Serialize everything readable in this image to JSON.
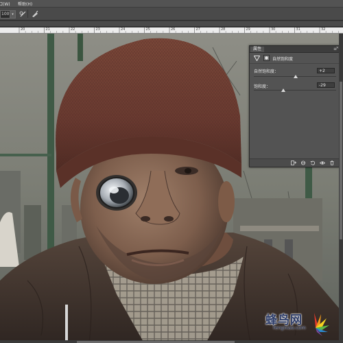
{
  "menu": {
    "window": "窗口(W)",
    "help": "帮助(H)"
  },
  "options": {
    "zoom": "100%"
  },
  "ruler": {
    "labels": [
      "20",
      "21",
      "22",
      "23",
      "24",
      "25",
      "26",
      "27",
      "28",
      "29",
      "30",
      "31",
      "32"
    ]
  },
  "panel": {
    "tab": "属性",
    "menu_icon": "≡",
    "title": "自然饱和度",
    "vibrance_label": "自然饱和度：",
    "vibrance_value": "+2",
    "saturation_label": "饱和度：",
    "saturation_value": "-29",
    "vibrance_level": 0.51,
    "saturation_level": 0.36
  },
  "watermark": {
    "text": "蜂鸟网",
    "url": "fengniao.com"
  },
  "colors": {
    "panel_bg": "#535353",
    "ui_dark": "#2b2b2b",
    "beanie": "#6a3a30",
    "jacket": "#4a3a30",
    "watermark_blue": "#2d3c68"
  },
  "icons": {
    "mask": "mask-icon",
    "vibrance": "vibrance-triangle-icon",
    "clip": "clip-to-layer-icon",
    "view_previous": "view-previous-icon",
    "reset": "reset-icon",
    "visibility": "eye-icon",
    "delete": "trash-icon"
  }
}
